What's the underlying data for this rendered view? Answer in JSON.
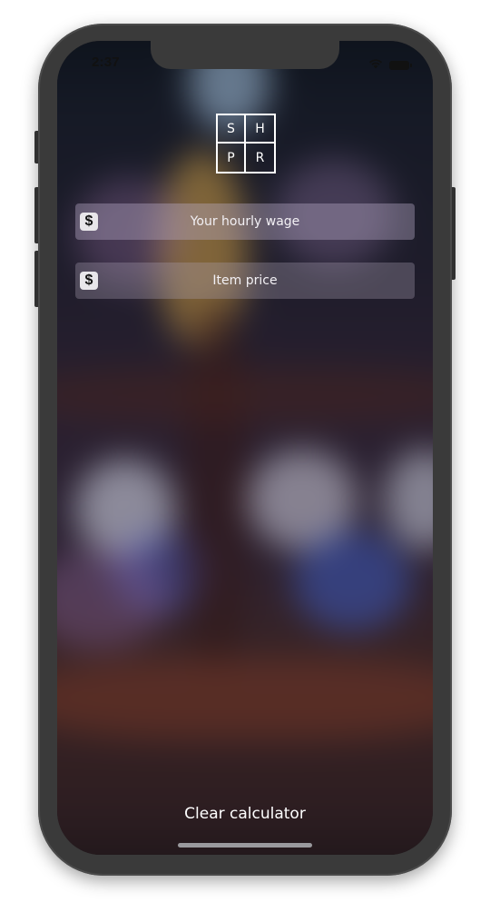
{
  "status_bar": {
    "time": "2:37",
    "wifi_icon": "wifi-icon",
    "battery_icon": "battery-icon"
  },
  "logo": {
    "letters": [
      "S",
      "H",
      "P",
      "R"
    ]
  },
  "form": {
    "wage": {
      "placeholder": "Your hourly wage",
      "value": "",
      "prefix": "$"
    },
    "price": {
      "placeholder": "Item price",
      "value": "",
      "prefix": "$"
    }
  },
  "actions": {
    "clear_label": "Clear calculator"
  },
  "colors": {
    "device_frame": "#3a3a3a",
    "text": "#ffffff",
    "field_bg": "#8c7fa0"
  }
}
